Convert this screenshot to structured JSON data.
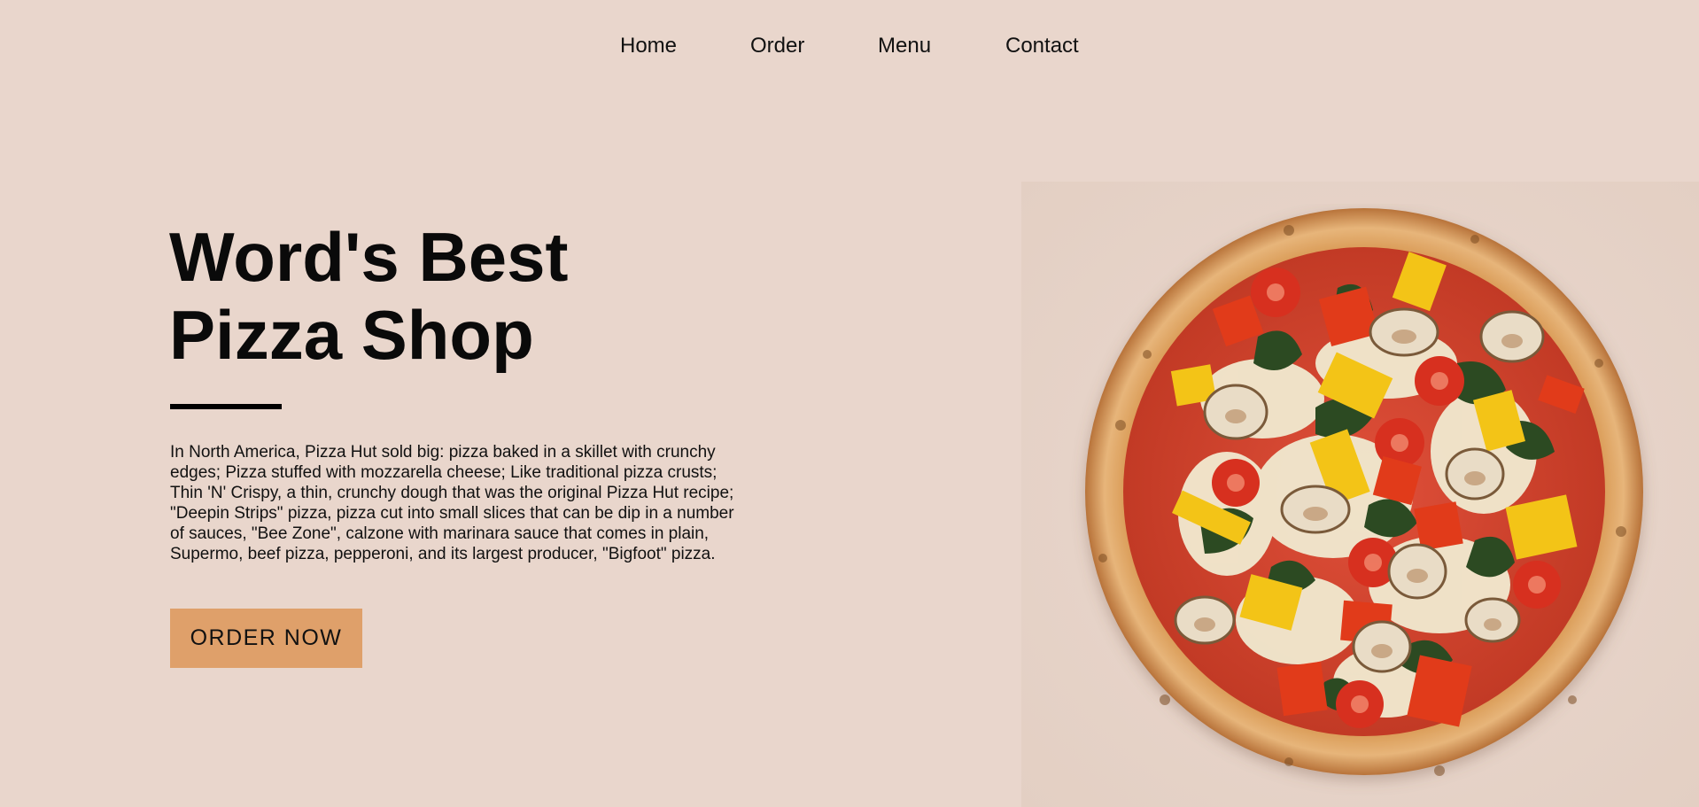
{
  "nav": {
    "items": [
      {
        "label": "Home"
      },
      {
        "label": "Order"
      },
      {
        "label": "Menu"
      },
      {
        "label": "Contact"
      }
    ]
  },
  "hero": {
    "title_line1": "Word's Best",
    "title_line2": "Pizza Shop",
    "description": "In North America, Pizza Hut sold big: pizza baked in a skillet with crunchy edges; Pizza stuffed with mozzarella cheese; Like traditional pizza crusts; Thin 'N' Crispy, a thin, crunchy dough that was the original Pizza Hut recipe; \"Deepin Strips\" pizza, pizza cut into small slices that can be dip in a number of sauces, \"Bee Zone\", calzone with marinara sauce that comes in plain, Supermo, beef pizza, pepperoni, and its largest producer, \"Bigfoot\" pizza.",
    "cta_label": "ORDER NOW"
  },
  "colors": {
    "background": "#e9d6cc",
    "button": "#dfa06a",
    "text": "#0b0b0b"
  },
  "image": {
    "subject": "pizza-with-vegetables-photo"
  }
}
